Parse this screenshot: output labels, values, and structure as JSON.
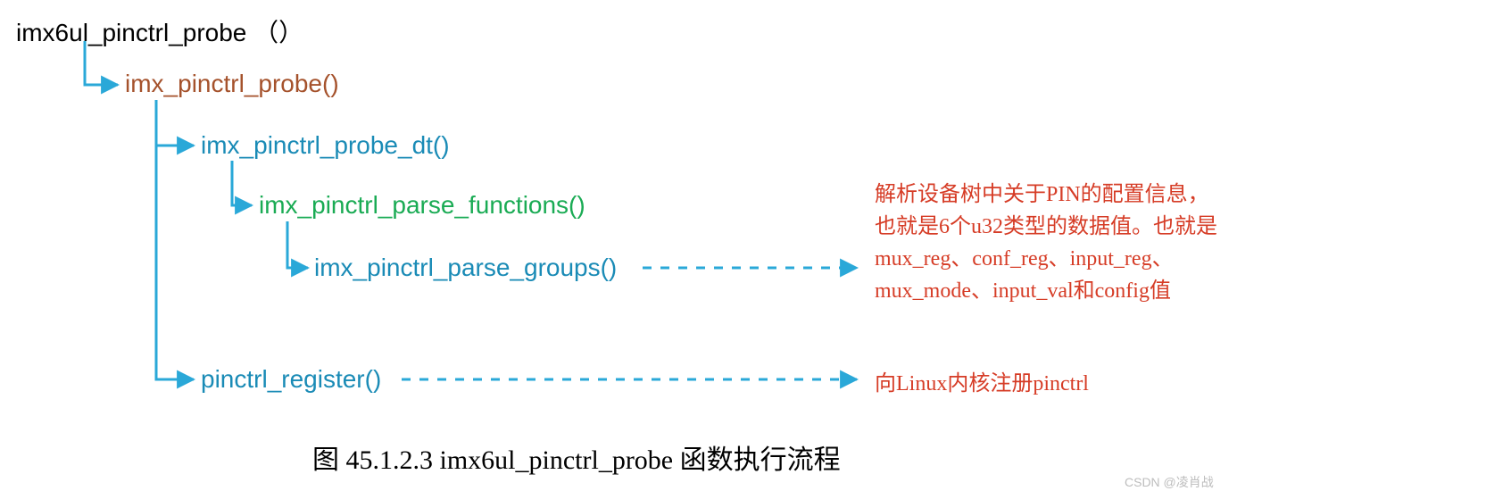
{
  "tree": {
    "root_label": "imx6ul_pinctrl_probe （）",
    "level1_label": "imx_pinctrl_probe()",
    "level2a_label": "imx_pinctrl_probe_dt()",
    "level3_label": "imx_pinctrl_parse_functions()",
    "level4_label": "imx_pinctrl_parse_groups()",
    "level2b_label": "pinctrl_register()"
  },
  "descriptions": {
    "parse_groups": "解析设备树中关于PIN的配置信息，也就是6个u32类型的数据值。也就是mux_reg、conf_reg、input_reg、mux_mode、input_val和config值",
    "register": "向Linux内核注册pinctrl"
  },
  "caption": "图 45.1.2.3 imx6ul_pinctrl_probe 函数执行流程",
  "watermark": "CSDN @凌肖战",
  "colors": {
    "tree_line": "#2aa8d8",
    "root_text": "#000000",
    "brown_text": "#a5522c",
    "blue_text": "#1a8bb6",
    "green_text": "#1aab54",
    "desc_text": "#d63c26"
  }
}
